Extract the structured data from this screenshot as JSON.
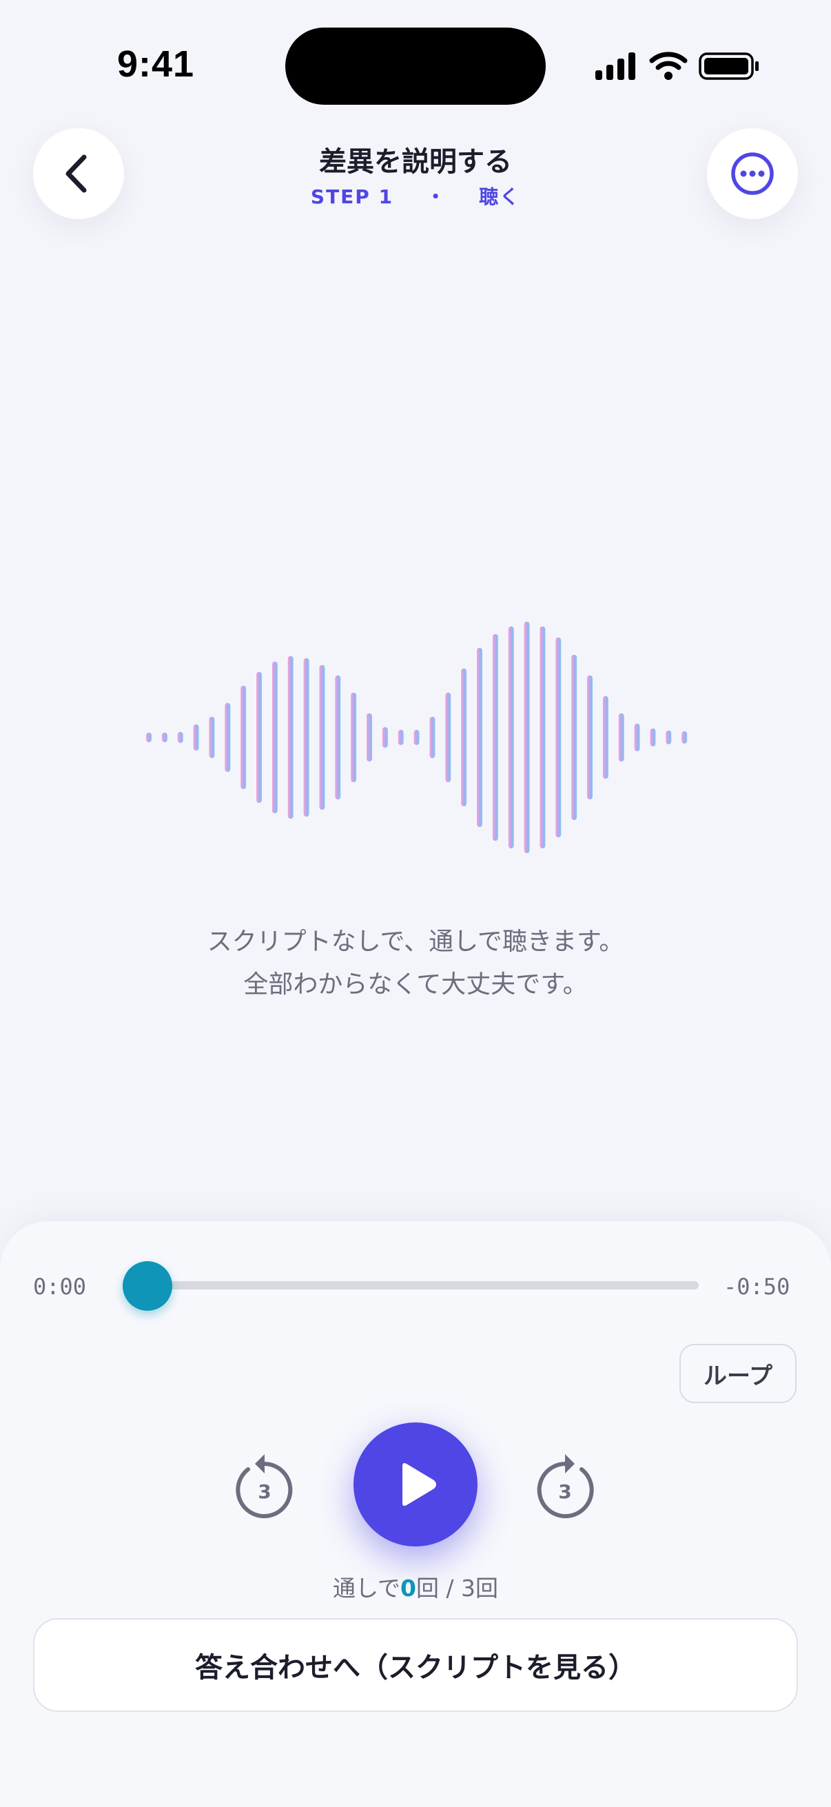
{
  "status_bar": {
    "time": "9:41"
  },
  "header": {
    "title": "差異を説明する",
    "step_label": "STEP 1",
    "separator": "・",
    "step_name": "聴く"
  },
  "waveform": {
    "colors": [
      "#f0a6d6",
      "#c9a6ec",
      "#9fb0ee",
      "#86c8f0"
    ]
  },
  "instruction": {
    "line1": "スクリプトなしで、通しで聴きます。",
    "line2": "全部わからなくて大丈夫です。"
  },
  "player": {
    "elapsed": "0:00",
    "remaining": "-0:50",
    "progress": 0,
    "loop_label": "ループ",
    "skip_back_seconds": "3",
    "skip_forward_seconds": "3",
    "count_prefix": "通しで",
    "count_value": "0",
    "count_suffix": "回 / 3回",
    "accent": "#4f46e5",
    "progress_color": "#0e95b7"
  },
  "answer_button": {
    "label": "答え合わせへ（スクリプトを見る）"
  }
}
